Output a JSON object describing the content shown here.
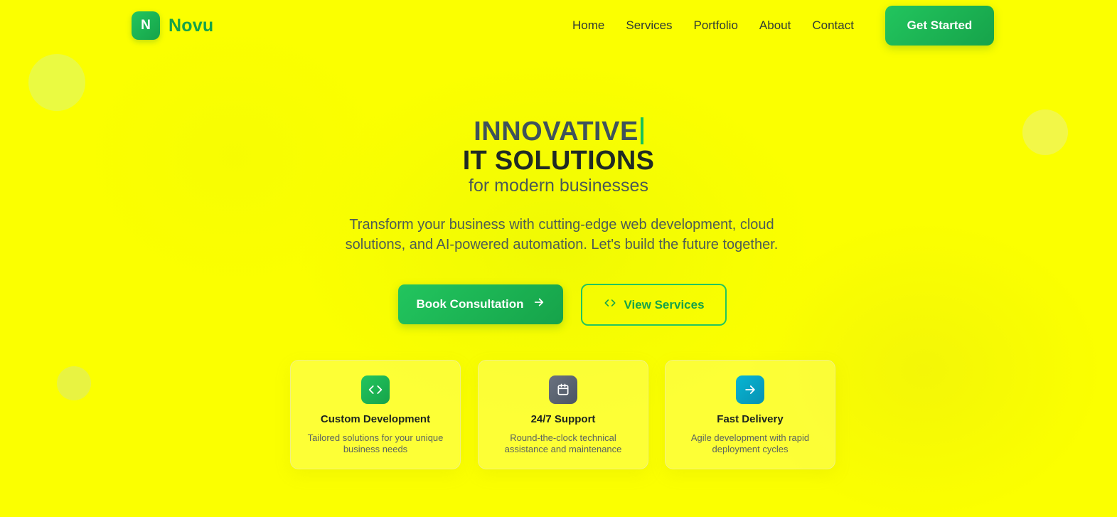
{
  "brand": {
    "logo_letter": "N",
    "name": "Novu"
  },
  "nav": {
    "items": [
      "Home",
      "Services",
      "Portfolio",
      "About",
      "Contact"
    ],
    "cta": "Get Started"
  },
  "hero": {
    "line1": "INNOVATIVE",
    "line2": "IT SOLUTIONS",
    "line3": "for modern businesses",
    "description": "Transform your business with cutting-edge web development, cloud solutions, and AI-powered automation. Let's build the future together.",
    "primary_button": "Book Consultation",
    "secondary_button": "View Services"
  },
  "features": [
    {
      "title": "Custom Development",
      "description": "Tailored solutions for your unique business needs",
      "icon": "code-icon",
      "color": "#22c55e"
    },
    {
      "title": "24/7 Support",
      "description": "Round-the-clock technical assistance and maintenance",
      "icon": "calendar-icon",
      "color": "#6b7280"
    },
    {
      "title": "Fast Delivery",
      "description": "Agile development with rapid deployment cycles",
      "icon": "arrow-right-icon",
      "color": "#06b6d4"
    }
  ],
  "colors": {
    "background": "#fbff00",
    "accent": "#22c55e",
    "accent_dark": "#16a34a"
  }
}
